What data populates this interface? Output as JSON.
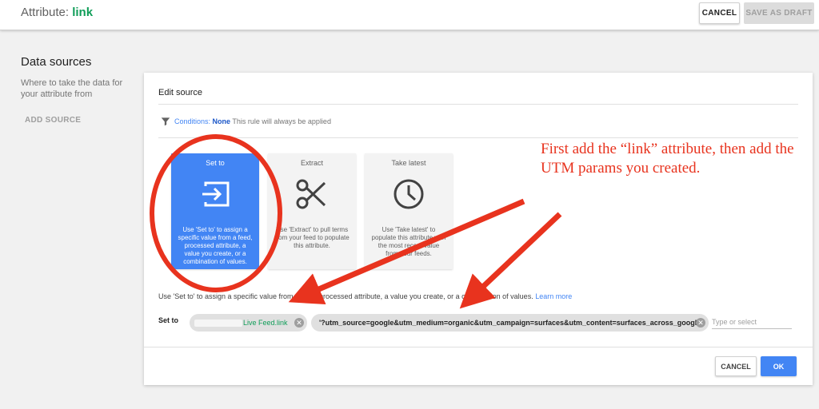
{
  "header": {
    "title_prefix": "Attribute: ",
    "attribute_name": "link",
    "cancel_label": "CANCEL",
    "save_draft_label": "SAVE AS DRAFT"
  },
  "sidebar": {
    "title": "Data sources",
    "description": "Where to take the data for your attribute from",
    "add_source_label": "ADD SOURCE"
  },
  "editor": {
    "heading": "Edit source",
    "conditions_label": "Conditions:",
    "conditions_value": "None",
    "conditions_note": "This rule will always be applied",
    "tiles": [
      {
        "label": "Set to",
        "icon": "input-arrow-icon",
        "description": "Use 'Set to' to assign a specific value from a feed, processed attribute, a value you create, or a combination of values.",
        "selected": true
      },
      {
        "label": "Extract",
        "icon": "scissors-icon",
        "description": "Use 'Extract' to pull terms from your feed to populate this attribute.",
        "selected": false
      },
      {
        "label": "Take latest",
        "icon": "clock-icon",
        "description": "Use 'Take latest' to populate this attribute with the most recent value from your feeds.",
        "selected": false
      }
    ],
    "explanation": "Use 'Set to' to assign a specific value from a feed, processed attribute, a value you create, or a combination of values.",
    "learn_more": "Learn more",
    "set_to_label": "Set to",
    "chips": [
      {
        "value": "Live Feed.link"
      },
      {
        "value": "'?utm_source=google&utm_medium=organic&utm_campaign=surfaces&utm_content=surfaces_across_google'"
      }
    ],
    "input_placeholder": "Type or select",
    "cancel_label": "CANCEL",
    "ok_label": "OK"
  },
  "annotation": {
    "text": "First add the “link” attribute, then add the UTM params you created.",
    "color": "#e8331e"
  },
  "colors": {
    "accent": "#4285f4",
    "attribute_green": "#0f9d58",
    "annotation_red": "#e8331e"
  }
}
